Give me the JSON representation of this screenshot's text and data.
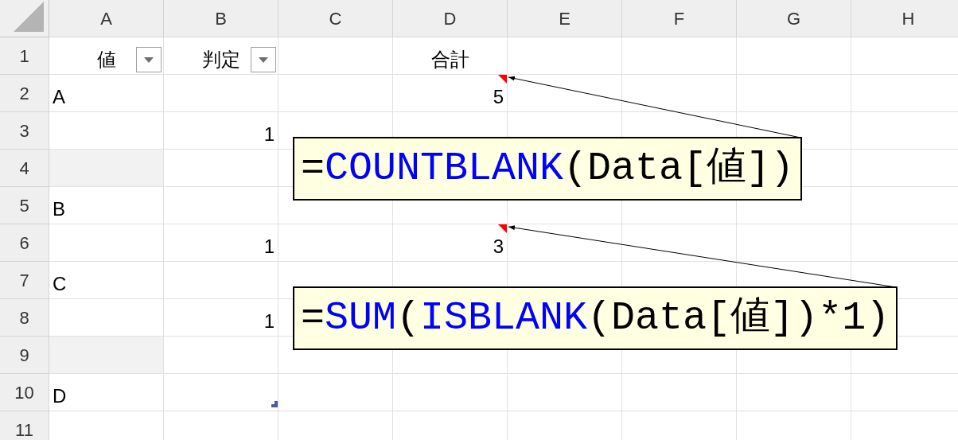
{
  "column_headers": [
    "A",
    "B",
    "C",
    "D",
    "E",
    "F",
    "G",
    "H"
  ],
  "rows": [
    {
      "number": "1",
      "cells": [
        {
          "text": "値",
          "kind": "header",
          "filter": true
        },
        {
          "text": "判定",
          "kind": "header",
          "filter": true
        },
        {},
        {
          "text": "合計",
          "kind": "header"
        },
        {},
        {},
        {},
        {}
      ]
    },
    {
      "number": "2",
      "cells": [
        {
          "text": "A",
          "kind": "text"
        },
        {},
        {},
        {
          "text": "5",
          "kind": "number",
          "comment": {
            "segments": [
              {
                "text": "=",
                "kind": "plain"
              },
              {
                "text": "COUNTBLANK",
                "kind": "function"
              },
              {
                "text": "(Data[値])",
                "kind": "plain"
              }
            ]
          }
        },
        {},
        {},
        {},
        {}
      ]
    },
    {
      "number": "3",
      "cells": [
        {},
        {
          "text": "1",
          "kind": "number"
        },
        {},
        {},
        {},
        {},
        {},
        {}
      ]
    },
    {
      "number": "4",
      "cells": [
        {
          "shaded": true
        },
        {},
        {},
        {},
        {},
        {},
        {},
        {}
      ]
    },
    {
      "number": "5",
      "cells": [
        {
          "text": "B",
          "kind": "text"
        },
        {},
        {},
        {},
        {},
        {},
        {},
        {}
      ]
    },
    {
      "number": "6",
      "cells": [
        {},
        {
          "text": "1",
          "kind": "number"
        },
        {},
        {
          "text": "3",
          "kind": "number",
          "comment": {
            "segments": [
              {
                "text": "=",
                "kind": "plain"
              },
              {
                "text": "SUM",
                "kind": "function"
              },
              {
                "text": "(",
                "kind": "plain"
              },
              {
                "text": "ISBLANK",
                "kind": "function"
              },
              {
                "text": "(Data[値])*1)",
                "kind": "plain"
              }
            ]
          }
        },
        {},
        {},
        {},
        {}
      ]
    },
    {
      "number": "7",
      "cells": [
        {
          "text": "C",
          "kind": "text"
        },
        {},
        {},
        {},
        {},
        {},
        {},
        {}
      ]
    },
    {
      "number": "8",
      "cells": [
        {},
        {
          "text": "1",
          "kind": "number"
        },
        {},
        {},
        {},
        {},
        {},
        {}
      ]
    },
    {
      "number": "9",
      "cells": [
        {
          "shaded": true
        },
        {},
        {},
        {},
        {},
        {},
        {},
        {}
      ]
    },
    {
      "number": "10",
      "cells": [
        {
          "text": "D",
          "kind": "text"
        },
        {},
        {},
        {},
        {},
        {},
        {},
        {}
      ]
    },
    {
      "number": "11",
      "cells": [
        {},
        {},
        {},
        {},
        {},
        {},
        {},
        {}
      ]
    }
  ]
}
